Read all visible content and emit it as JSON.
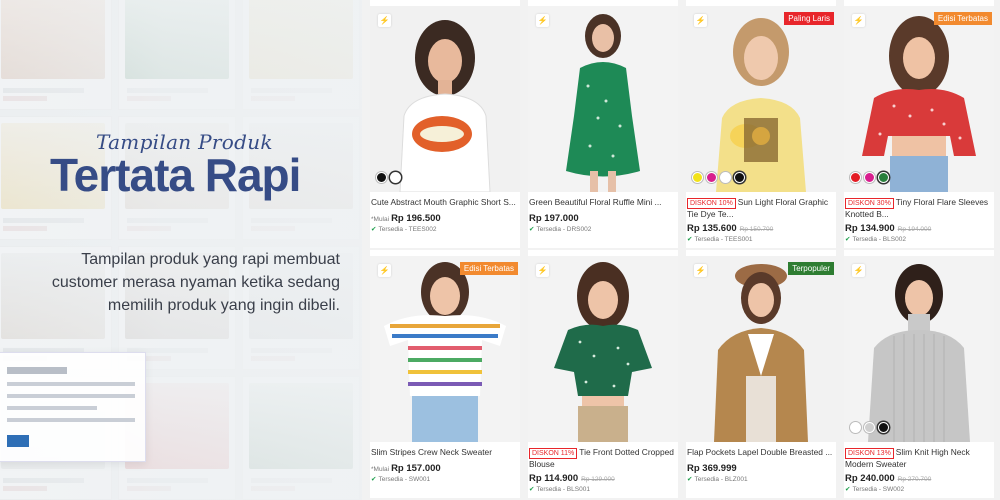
{
  "banner": {
    "script_title": "Tampilan Produk",
    "main_title": "Tertata Rapi",
    "description": "Tampilan produk yang rapi membuat customer merasa nyaman ketika sedang memilih produk yang ingin dibeli."
  },
  "products": [
    {
      "title": "Cute Abstract Mouth Graphic Short S...",
      "prefix": "*Mulai",
      "price": "Rp 196.500",
      "old_price": "",
      "discount": "",
      "badge": "",
      "stock": "Tersedia - TEES002",
      "swatches": [
        "#111111",
        "#ffffff"
      ]
    },
    {
      "title": "Green Beautiful Floral Ruffle Mini ...",
      "prefix": "",
      "price": "Rp 197.000",
      "old_price": "",
      "discount": "",
      "badge": "",
      "stock": "Tersedia - DRS002",
      "swatches": []
    },
    {
      "title": "Sun Light Floral Graphic Tie Dye Te...",
      "prefix": "",
      "price": "Rp 135.600",
      "old_price": "Rp 150.700",
      "discount": "DISKON 10%",
      "badge": "Paling Laris",
      "stock": "Tersedia - TEES001",
      "swatches": [
        "#f2e21a",
        "#d81e8e",
        "#ffffff",
        "#111111"
      ]
    },
    {
      "title": "Tiny Floral Flare Sleeves Knotted B...",
      "prefix": "",
      "price": "Rp 134.900",
      "old_price": "Rp 194.000",
      "discount": "DISKON 30%",
      "badge": "Edisi Terbatas",
      "stock": "Tersedia - BLS002",
      "swatches": [
        "#e31b23",
        "#d81e8e",
        "#2a7f3c"
      ]
    },
    {
      "title": "Slim Stripes Crew Neck Sweater",
      "prefix": "*Mulai",
      "price": "Rp 157.000",
      "old_price": "",
      "discount": "",
      "badge": "Edisi Terbatas",
      "stock": "Tersedia - SW001",
      "swatches": []
    },
    {
      "title": "Tie Front Dotted Cropped Blouse",
      "prefix": "",
      "price": "Rp 114.900",
      "old_price": "Rp 129.000",
      "discount": "DISKON 11%",
      "badge": "",
      "stock": "Tersedia - BLS001",
      "swatches": []
    },
    {
      "title": "Flap Pockets Lapel Double Breasted ...",
      "prefix": "",
      "price": "Rp 369.999",
      "old_price": "",
      "discount": "",
      "badge": "Terpopuler",
      "stock": "Tersedia - BLZ001",
      "swatches": []
    },
    {
      "title": "Slim Knit High Neck Modern Sweater",
      "prefix": "",
      "price": "Rp 240.000",
      "old_price": "Rp 270.700",
      "discount": "DISKON 13%",
      "badge": "",
      "stock": "Tersedia - SW002",
      "swatches": [
        "#ffffff",
        "#cfcfcf",
        "#111111"
      ]
    }
  ],
  "colors": {
    "title_blue": "#364c86",
    "sale_red": "#e8262b",
    "badge_orange": "#f28a2f",
    "badge_green": "#2e7d32",
    "stock_green": "#1a9e4a"
  }
}
